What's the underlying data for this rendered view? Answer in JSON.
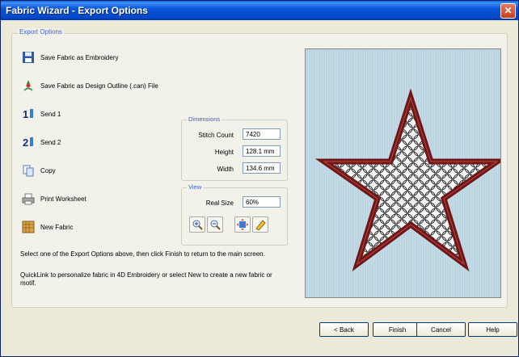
{
  "window": {
    "title": "Fabric Wizard - Export Options"
  },
  "group": {
    "label": "Export Options"
  },
  "options": [
    {
      "label": "Save Fabric as Embroidery",
      "icon": "floppy-disk-icon"
    },
    {
      "label": "Save Fabric as Design Outline (.can) File",
      "icon": "design-outline-icon"
    },
    {
      "label": "Send 1",
      "icon": "send-1-icon",
      "glyph": "1"
    },
    {
      "label": "Send 2",
      "icon": "send-2-icon",
      "glyph": "2"
    },
    {
      "label": "Copy",
      "icon": "copy-icon"
    },
    {
      "label": "Print Worksheet",
      "icon": "printer-icon"
    },
    {
      "label": "New Fabric",
      "icon": "new-fabric-icon"
    }
  ],
  "info": {
    "line1": "Select one of the Export Options above, then click Finish to return to the main screen.",
    "line2": "QuickLink to personalize fabric in 4D Embroidery or select New to create a new fabric or motif."
  },
  "dimensions": {
    "label": "Dimensions",
    "stitch_count_label": "Stitch Count",
    "stitch_count": "7420",
    "height_label": "Height",
    "height": "128.1 mm",
    "width_label": "Width",
    "width": "134.6 mm"
  },
  "view": {
    "label": "View",
    "real_size_label": "Real Size",
    "real_size": "60%",
    "tools": [
      "zoom-in-icon",
      "zoom-out-icon",
      "fit-view-icon",
      "measure-icon"
    ]
  },
  "footer": {
    "back": "< Back",
    "finish": "Finish",
    "cancel": "Cancel",
    "help": "Help"
  },
  "colors": {
    "title_bar": "#0a55d8",
    "accent_label": "#3d5fd0",
    "star_outline": "#7a1a1a",
    "fabric": "#b9d3e0"
  }
}
